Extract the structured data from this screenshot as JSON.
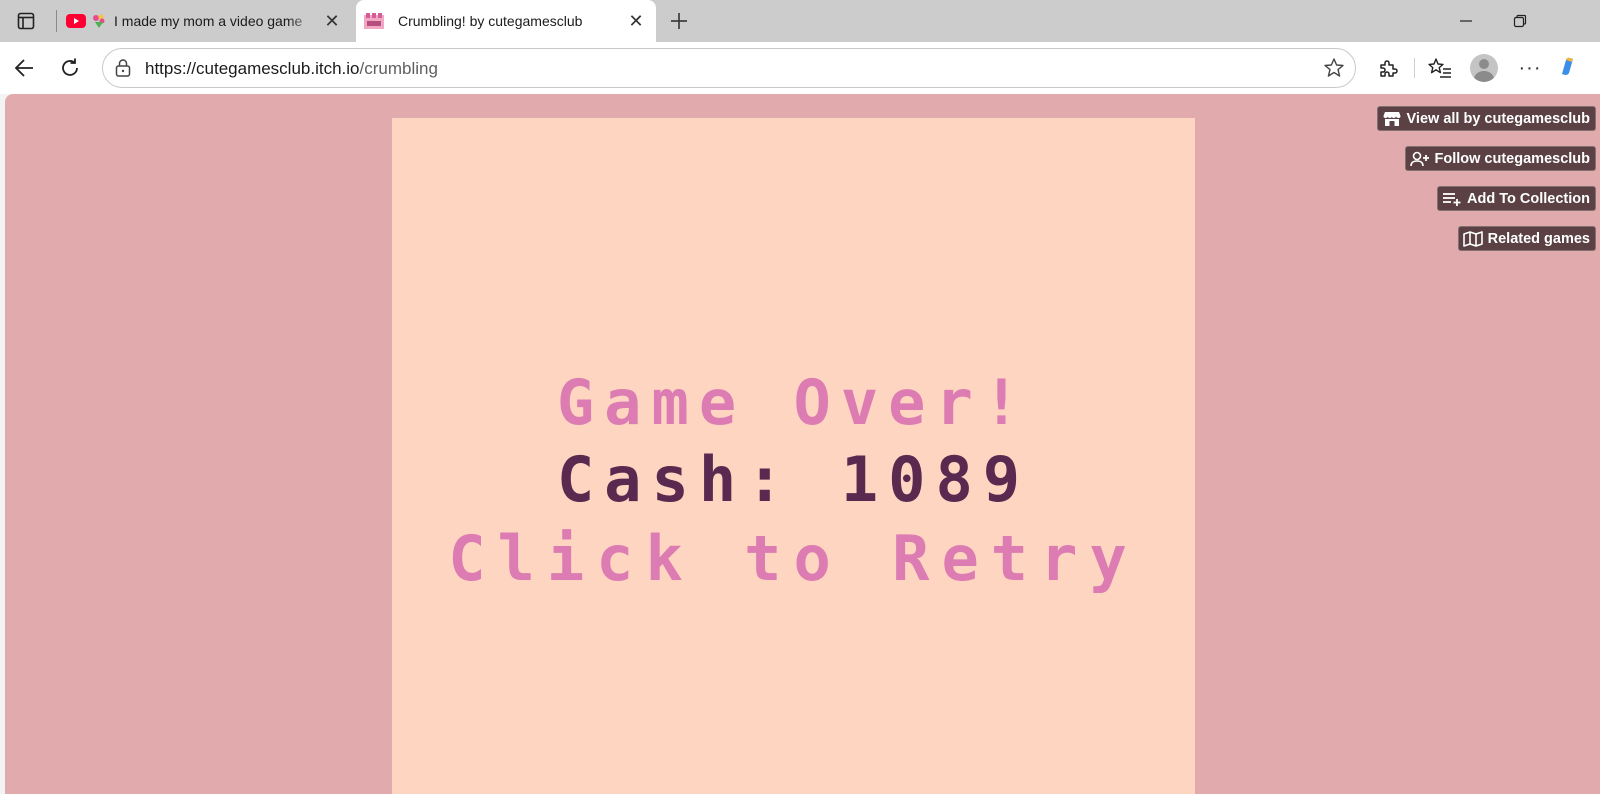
{
  "browser": {
    "tabs": [
      {
        "title": "I made my mom a video game",
        "active": false,
        "favicon": "youtube-icon"
      },
      {
        "title": "Crumbling! by cutegamesclub",
        "active": true,
        "favicon": "itch-game-icon"
      }
    ],
    "address": {
      "host": "https://cutegamesclub.itch.io",
      "path": "/crumbling"
    }
  },
  "page": {
    "buttons": {
      "view_all": "View all by cutegamesclub",
      "follow": "Follow cutegamesclub",
      "collection": "Add To Collection",
      "related": "Related games"
    },
    "game": {
      "title": "Game Over!",
      "cash": "Cash: 1089",
      "retry": "Click to Retry"
    }
  },
  "colors": {
    "page_bg": "#e1aaad",
    "game_bg": "#fdd5c0",
    "pink_text": "#dd7bb3",
    "dark_text": "#5a2950",
    "button_bg": "#5b4144"
  }
}
